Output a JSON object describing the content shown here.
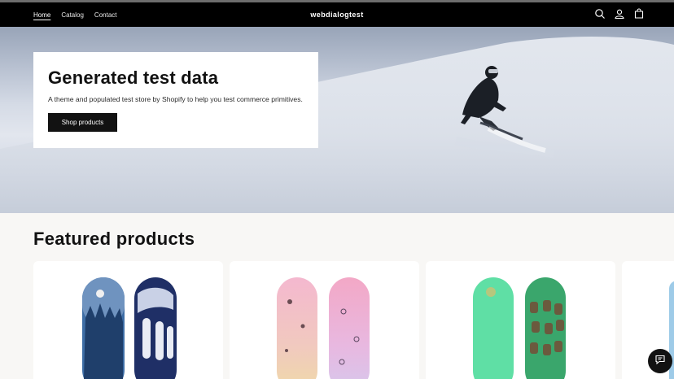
{
  "header": {
    "nav": [
      {
        "label": "Home"
      },
      {
        "label": "Catalog"
      },
      {
        "label": "Contact"
      }
    ],
    "brand": "webdialogtest",
    "icons": [
      "search-icon",
      "account-icon",
      "cart-icon"
    ]
  },
  "hero": {
    "title": "Generated test data",
    "subtitle": "A theme and populated test store by Shopify to help you test commerce primitives.",
    "button_label": "Shop products"
  },
  "featured": {
    "title": "Featured products",
    "products": [
      {
        "image": "blue-forest-snowboard"
      },
      {
        "image": "pink-pastel-snowboard"
      },
      {
        "image": "green-characters-snowboard"
      },
      {
        "image": "light-blue-snowboard"
      }
    ]
  },
  "chat": {
    "icon": "chat-icon"
  }
}
